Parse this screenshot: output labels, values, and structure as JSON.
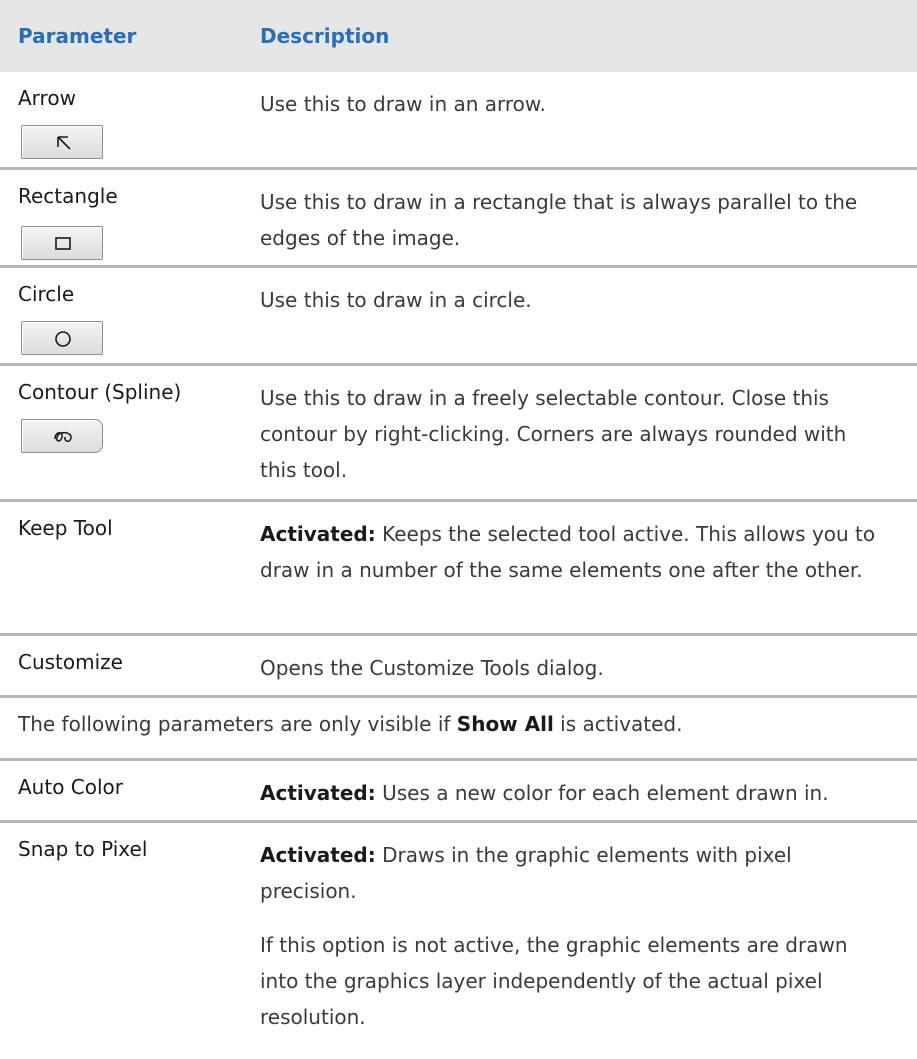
{
  "header": {
    "parameter": "Parameter",
    "description": "Description"
  },
  "rows": {
    "arrow": {
      "param": "Arrow",
      "icon": "arrow-up-left-icon",
      "desc": "Use this to draw in an arrow."
    },
    "rectangle": {
      "param": "Rectangle",
      "icon": "rectangle-icon",
      "desc": "Use this to draw in a rectangle that is always parallel to the edges of the image."
    },
    "circle": {
      "param": "Circle",
      "icon": "circle-icon",
      "desc": "Use this to draw in a circle."
    },
    "contour": {
      "param": "Contour (Spline)",
      "icon": "spline-icon",
      "desc": "Use this to draw in a freely selectable contour. Close this contour by right-clicking. Corners are always rounded with this tool."
    },
    "keep_tool": {
      "param": "Keep Tool",
      "desc_bold": "Activated:",
      "desc": " Keeps the selected tool active. This allows you to draw in a number of the same elements one after the other."
    },
    "customize": {
      "param": "Customize",
      "desc": "Opens the Customize Tools dialog."
    },
    "note": {
      "before": "The following parameters are only visible if ",
      "bold": "Show All",
      "after": " is activated."
    },
    "auto_color": {
      "param": "Auto Color",
      "desc_bold": "Activated:",
      "desc": " Uses a new color for each element drawn in."
    },
    "snap_to_pixel": {
      "param": "Snap to Pixel",
      "desc_bold": "Activated:",
      "desc": " Draws in the graphic elements with pixel precision.",
      "desc2": "If this option is not active, the graphic elements are drawn into the graphics layer independently of the actual pixel resolution."
    }
  },
  "colors": {
    "header_text": "#2a6ebb",
    "header_bg": "#e6e6e6",
    "divider": "#b8b8b8"
  }
}
